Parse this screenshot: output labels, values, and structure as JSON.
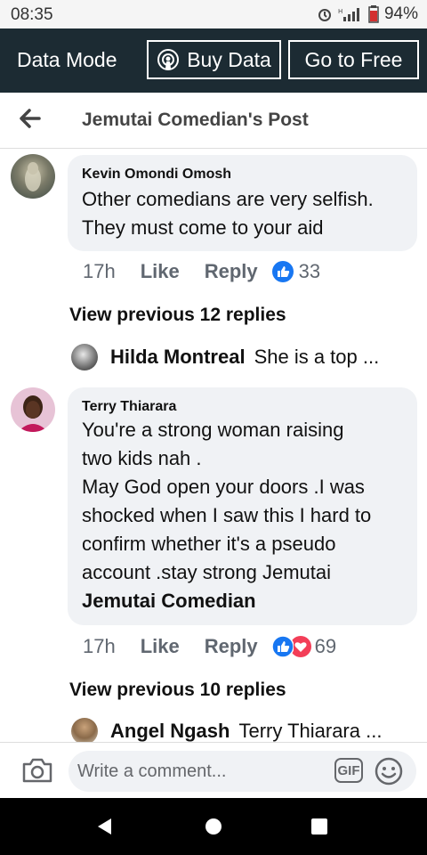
{
  "status": {
    "time": "08:35",
    "battery": "94%"
  },
  "topbar": {
    "mode_label": "Data Mode",
    "buy_label": "Buy Data",
    "free_label": "Go to Free"
  },
  "header": {
    "title": "Jemutai Comedian's Post"
  },
  "comments": [
    {
      "author": "Kevin Omondi Omosh",
      "lines": [
        "Other comedians are very selfish.",
        "They must come to your aid"
      ],
      "time": "17h",
      "like_label": "Like",
      "reply_label": "Reply",
      "reactions": "33",
      "view_prev": "View previous 12 replies",
      "reply": {
        "name": "Hilda Montreal",
        "text": "She is a top ..."
      }
    },
    {
      "author": "Terry Thiarara",
      "lines": [
        "You're a strong woman raising",
        "two kids nah .",
        "May God open your doors  .I was",
        "shocked when I saw this I hard to",
        "confirm whether it's  a pseudo",
        "account .stay strong Jemutai"
      ],
      "tag": "Jemutai Comedian",
      "time": "17h",
      "like_label": "Like",
      "reply_label": "Reply",
      "reactions": "69",
      "view_prev": "View previous 10 replies",
      "reply": {
        "name": "Angel Ngash",
        "text": "Terry Thiarara ..."
      }
    }
  ],
  "composer": {
    "placeholder": "Write a comment...",
    "gif_label": "GIF"
  },
  "colors": {
    "topbar": "#1c2b33",
    "bubble": "#f0f2f5",
    "like_blue": "#1877f2",
    "love_red": "#f33e58"
  },
  "icons": [
    "back-arrow-icon",
    "podcast-icon",
    "camera-icon",
    "gif-icon",
    "emoji-icon",
    "like-reaction-icon",
    "love-reaction-icon",
    "nav-back-icon",
    "nav-home-icon",
    "nav-recents-icon",
    "alarm-icon",
    "signal-icon",
    "battery-icon"
  ]
}
